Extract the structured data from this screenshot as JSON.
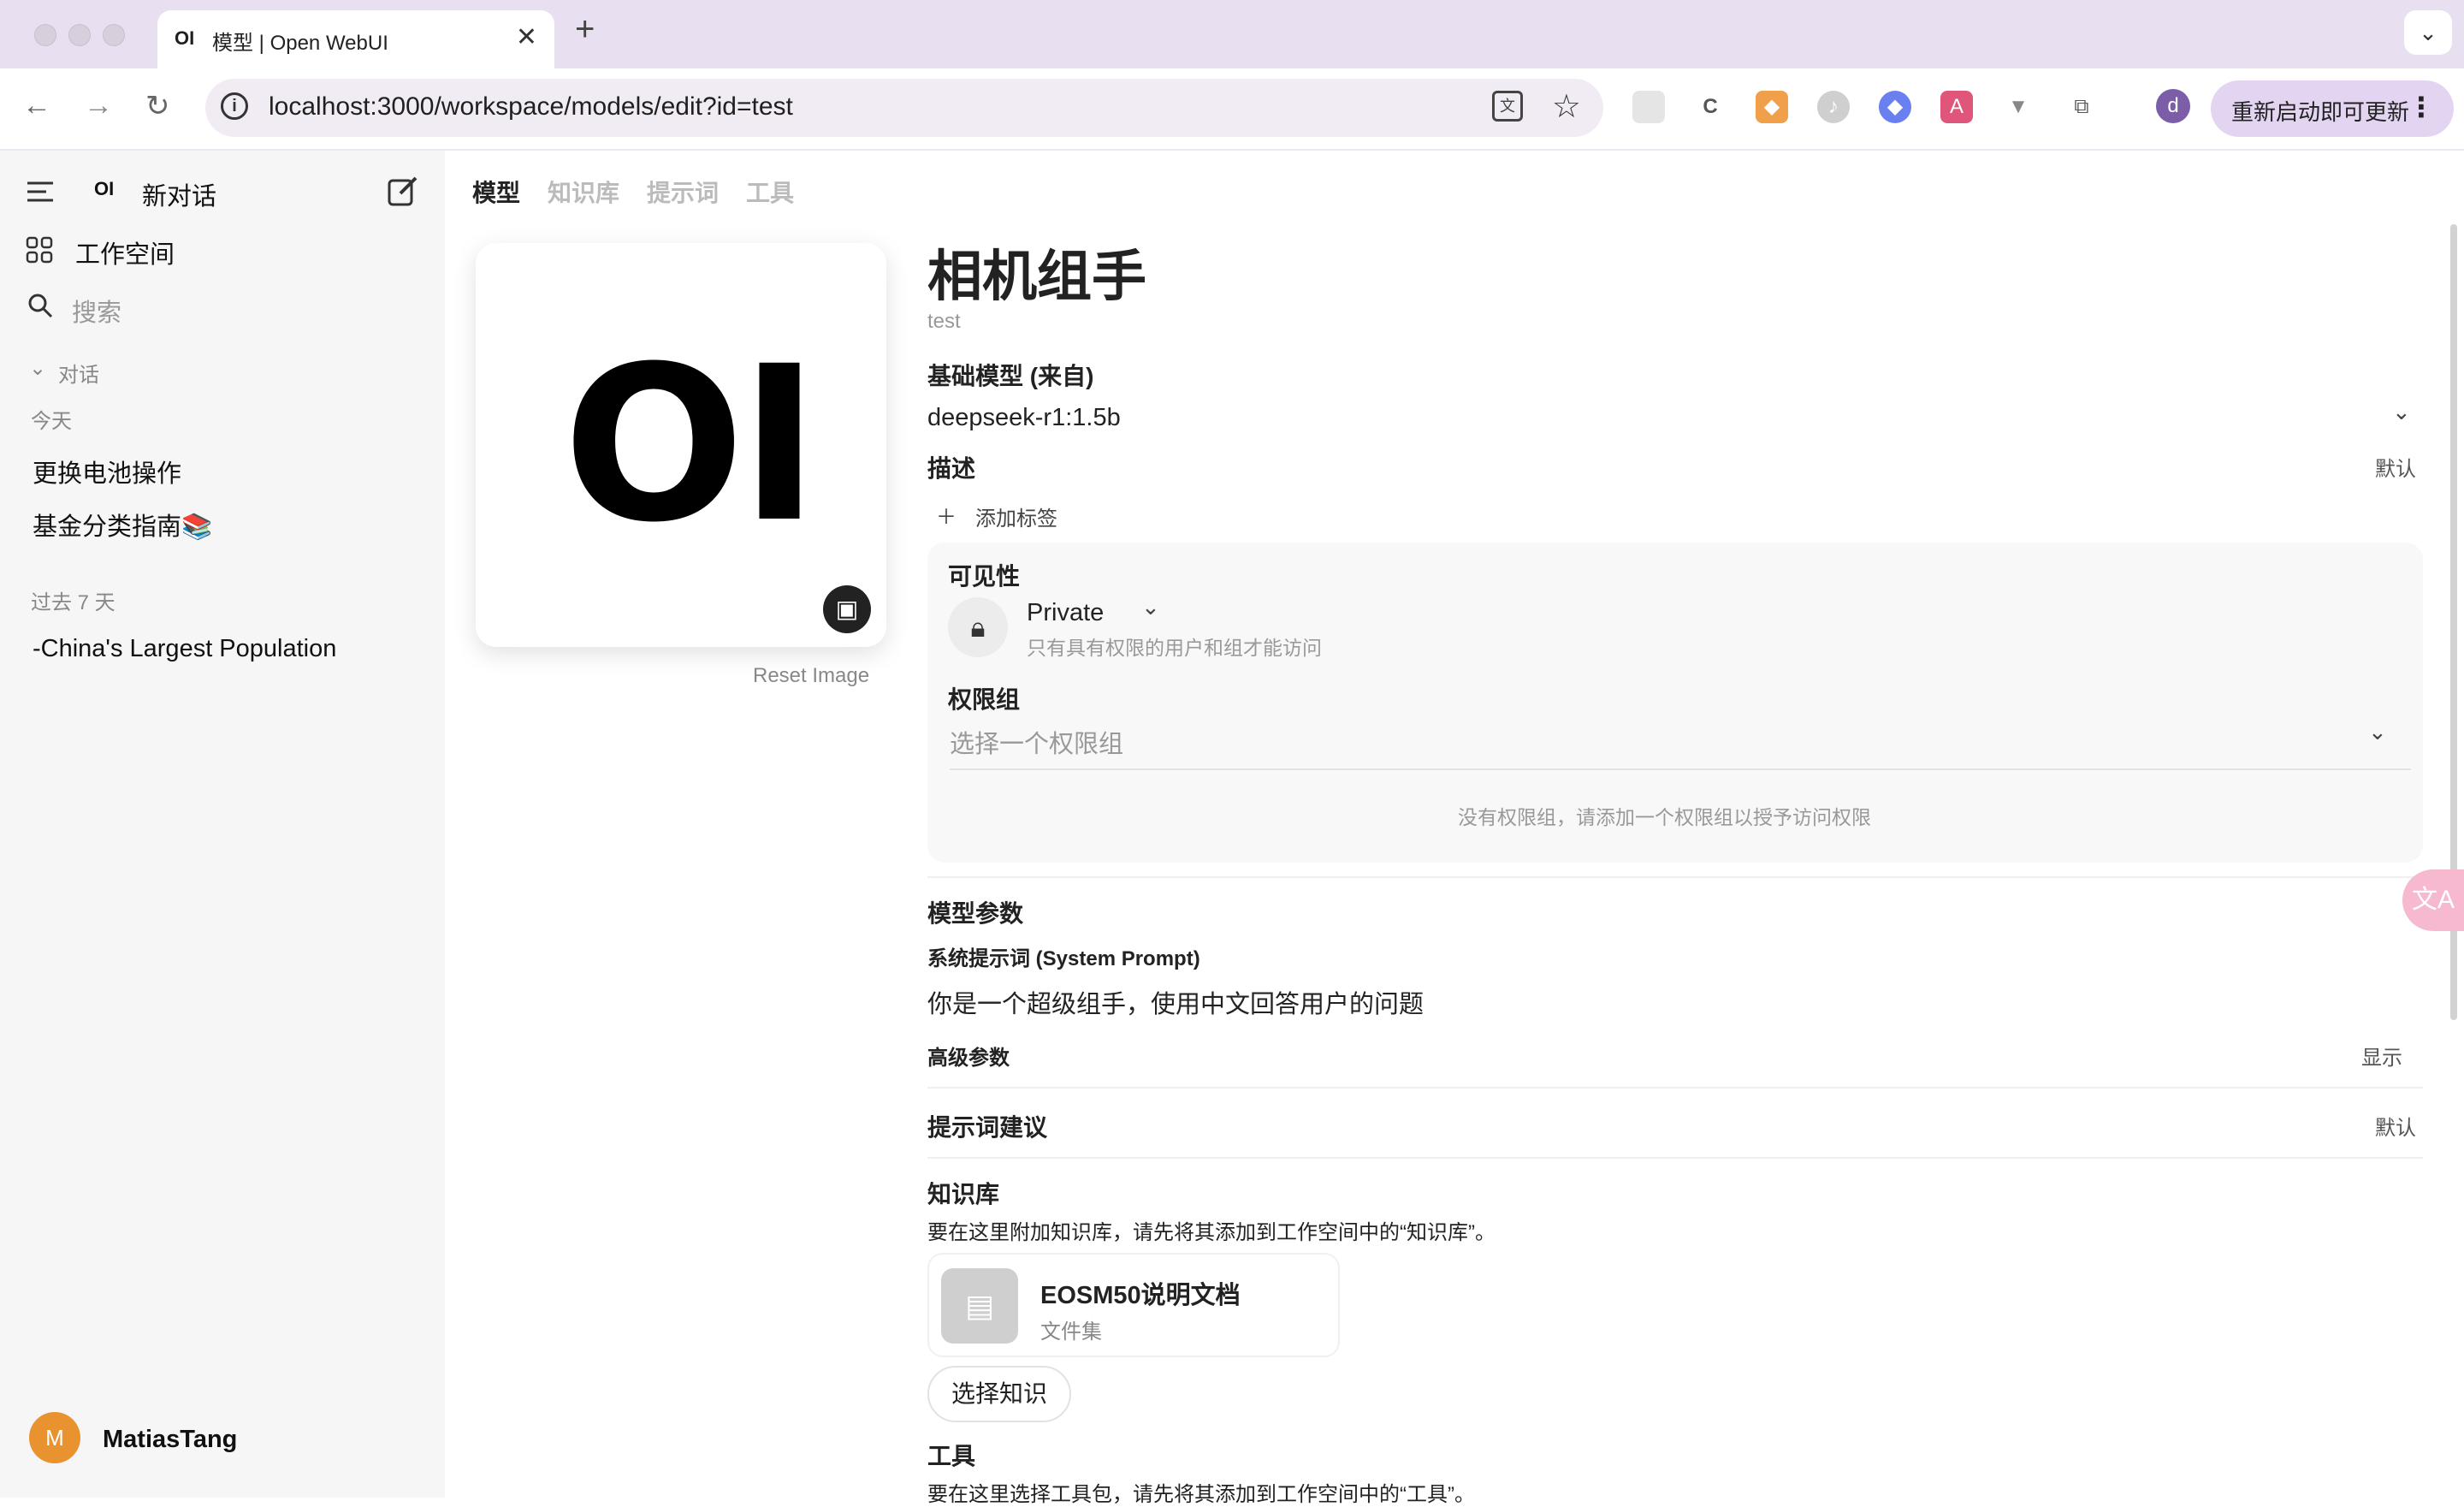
{
  "browser": {
    "tab_icon": "OI",
    "tab_title": "模型 | Open WebUI",
    "tab_close": "✕",
    "new_tab": "+",
    "tab_menu": "⌄",
    "url": "localhost:3000/workspace/models/edit?id=test",
    "profile_initial": "d",
    "update_label": "重新启动即可更新",
    "update_menu": "⋮"
  },
  "sidebar": {
    "logo": "OI",
    "new_chat": "新对话",
    "workspace": "工作空间",
    "search_placeholder": "搜索",
    "chats_header": "对话",
    "today_header": "今天",
    "today_items": [
      "更换电池操作",
      "基金分类指南📚"
    ],
    "past7_header": "过去 7 天",
    "past7_items": [
      "-China's Largest Population"
    ],
    "user_initial": "M",
    "user_name": "MatiasTang"
  },
  "nav_tabs": [
    "模型",
    "知识库",
    "提示词",
    "工具"
  ],
  "model": {
    "logo_text": "OI",
    "reset_image": "Reset Image",
    "name": "相机组手",
    "id": "test",
    "base_model_label": "基础模型 (来自)",
    "base_model_value": "deepseek-r1:1.5b",
    "description_label": "描述",
    "description_default": "默认",
    "add_tag": "添加标签",
    "visibility_label": "可见性",
    "visibility_value": "Private",
    "visibility_hint": "只有具有权限的用户和组才能访问",
    "group_label": "权限组",
    "group_placeholder": "选择一个权限组",
    "group_empty": "没有权限组，请添加一个权限组以授予访问权限",
    "params_label": "模型参数",
    "system_prompt_label": "系统提示词 (System Prompt)",
    "system_prompt_value": "你是一个超级组手，使用中文回答用户的问题",
    "advanced_label": "高级参数",
    "advanced_toggle": "显示",
    "suggestions_label": "提示词建议",
    "suggestions_default": "默认",
    "knowledge_label": "知识库",
    "knowledge_hint": "要在这里附加知识库，请先将其添加到工作空间中的“知识库”。",
    "knowledge_item_name": "EOSM50说明文档",
    "knowledge_item_type": "文件集",
    "choose_knowledge": "选择知识",
    "tools_label": "工具",
    "tools_hint": "要在这里选择工具包，请先将其添加到工作空间中的“工具”。"
  },
  "colors": {
    "tabbar_bg": "#e8dff0",
    "sidebar_bg": "#f7f6f6",
    "avatar": "#e8932f",
    "profile": "#7b5ea7",
    "update_pill": "#e3d5f2"
  }
}
